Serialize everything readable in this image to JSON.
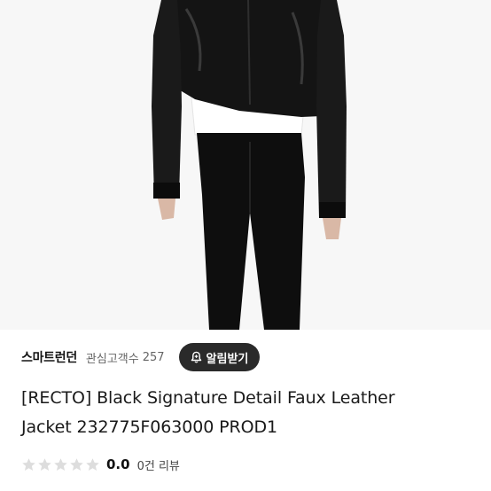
{
  "product": {
    "image_alt": "black cropped faux leather jacket worn over white top and black pants",
    "title_line1": "[RECTO] Black Signature Detail Faux Leather",
    "title_line2": "Jacket 232775F063000 PROD1"
  },
  "store": {
    "name": "스마트런던",
    "follower_label": "관심고객수",
    "follower_count": "257",
    "notify_label": "알림받기",
    "notify_icon": "bell-plus-icon"
  },
  "rating": {
    "stars": 0,
    "max_stars": 5,
    "value": "0.0",
    "review_count": "0건 리뷰"
  },
  "colors": {
    "jacket": "#141414",
    "button_bg": "#2a2a2a",
    "star_empty": "#dddddd"
  }
}
